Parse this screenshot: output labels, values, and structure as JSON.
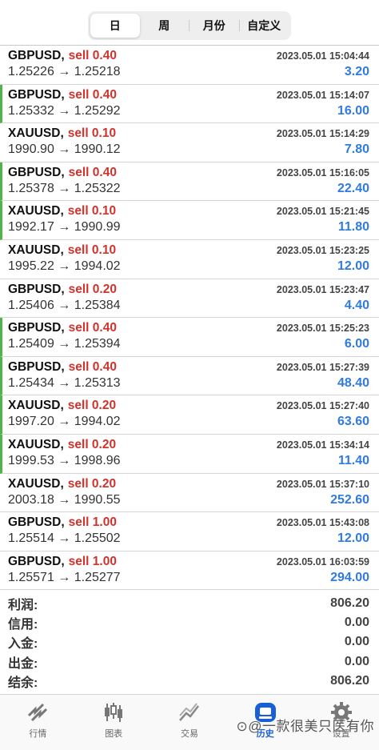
{
  "period_tabs": [
    {
      "label": "日",
      "active": true
    },
    {
      "label": "周",
      "active": false
    },
    {
      "label": "月份",
      "active": false
    },
    {
      "label": "自定义",
      "active": false
    }
  ],
  "trades": [
    {
      "symbol": "GBPUSD,",
      "side": "sell 0.40",
      "time": "2023.05.01 15:04:44",
      "prices": "1.25226 → 1.25218",
      "profit": "3.20",
      "marker": false
    },
    {
      "symbol": "GBPUSD,",
      "side": "sell 0.40",
      "time": "2023.05.01 15:14:07",
      "prices": "1.25332 → 1.25292",
      "profit": "16.00",
      "marker": true
    },
    {
      "symbol": "XAUUSD,",
      "side": "sell 0.10",
      "time": "2023.05.01 15:14:29",
      "prices": "1990.90 → 1990.12",
      "profit": "7.80",
      "marker": false
    },
    {
      "symbol": "GBPUSD,",
      "side": "sell 0.40",
      "time": "2023.05.01 15:16:05",
      "prices": "1.25378 → 1.25322",
      "profit": "22.40",
      "marker": true
    },
    {
      "symbol": "XAUUSD,",
      "side": "sell 0.10",
      "time": "2023.05.01 15:21:45",
      "prices": "1992.17 → 1990.99",
      "profit": "11.80",
      "marker": true
    },
    {
      "symbol": "XAUUSD,",
      "side": "sell 0.10",
      "time": "2023.05.01 15:23:25",
      "prices": "1995.22 → 1994.02",
      "profit": "12.00",
      "marker": false
    },
    {
      "symbol": "GBPUSD,",
      "side": "sell 0.20",
      "time": "2023.05.01 15:23:47",
      "prices": "1.25406 → 1.25384",
      "profit": "4.40",
      "marker": false
    },
    {
      "symbol": "GBPUSD,",
      "side": "sell 0.40",
      "time": "2023.05.01 15:25:23",
      "prices": "1.25409 → 1.25394",
      "profit": "6.00",
      "marker": true
    },
    {
      "symbol": "GBPUSD,",
      "side": "sell 0.40",
      "time": "2023.05.01 15:27:39",
      "prices": "1.25434 → 1.25313",
      "profit": "48.40",
      "marker": true
    },
    {
      "symbol": "XAUUSD,",
      "side": "sell 0.20",
      "time": "2023.05.01 15:27:40",
      "prices": "1997.20 → 1994.02",
      "profit": "63.60",
      "marker": true
    },
    {
      "symbol": "XAUUSD,",
      "side": "sell 0.20",
      "time": "2023.05.01 15:34:14",
      "prices": "1999.53 → 1998.96",
      "profit": "11.40",
      "marker": true
    },
    {
      "symbol": "XAUUSD,",
      "side": "sell 0.20",
      "time": "2023.05.01 15:37:10",
      "prices": "2003.18 → 1990.55",
      "profit": "252.60",
      "marker": false
    },
    {
      "symbol": "GBPUSD,",
      "side": "sell 1.00",
      "time": "2023.05.01 15:43:08",
      "prices": "1.25514 → 1.25502",
      "profit": "12.00",
      "marker": false
    },
    {
      "symbol": "GBPUSD,",
      "side": "sell 1.00",
      "time": "2023.05.01 16:03:59",
      "prices": "1.25571 → 1.25277",
      "profit": "294.00",
      "marker": false
    }
  ],
  "summary": [
    {
      "label": "利润:",
      "value": "806.20"
    },
    {
      "label": "信用:",
      "value": "0.00"
    },
    {
      "label": "入金:",
      "value": "0.00"
    },
    {
      "label": "出金:",
      "value": "0.00"
    },
    {
      "label": "结余:",
      "value": "806.20"
    }
  ],
  "tabbar": [
    {
      "label": "行情",
      "icon": "quotes-icon",
      "active": false
    },
    {
      "label": "图表",
      "icon": "chart-icon",
      "active": false
    },
    {
      "label": "交易",
      "icon": "trade-icon",
      "active": false
    },
    {
      "label": "历史",
      "icon": "history-icon",
      "active": true
    },
    {
      "label": "设置",
      "icon": "settings-icon",
      "active": false
    }
  ],
  "watermark": "⊙@一款很美只医有你",
  "colors": {
    "sell": "#d0322c",
    "profit": "#2f7bde",
    "marker": "#4fb548",
    "active_tab": "#1760d6"
  }
}
